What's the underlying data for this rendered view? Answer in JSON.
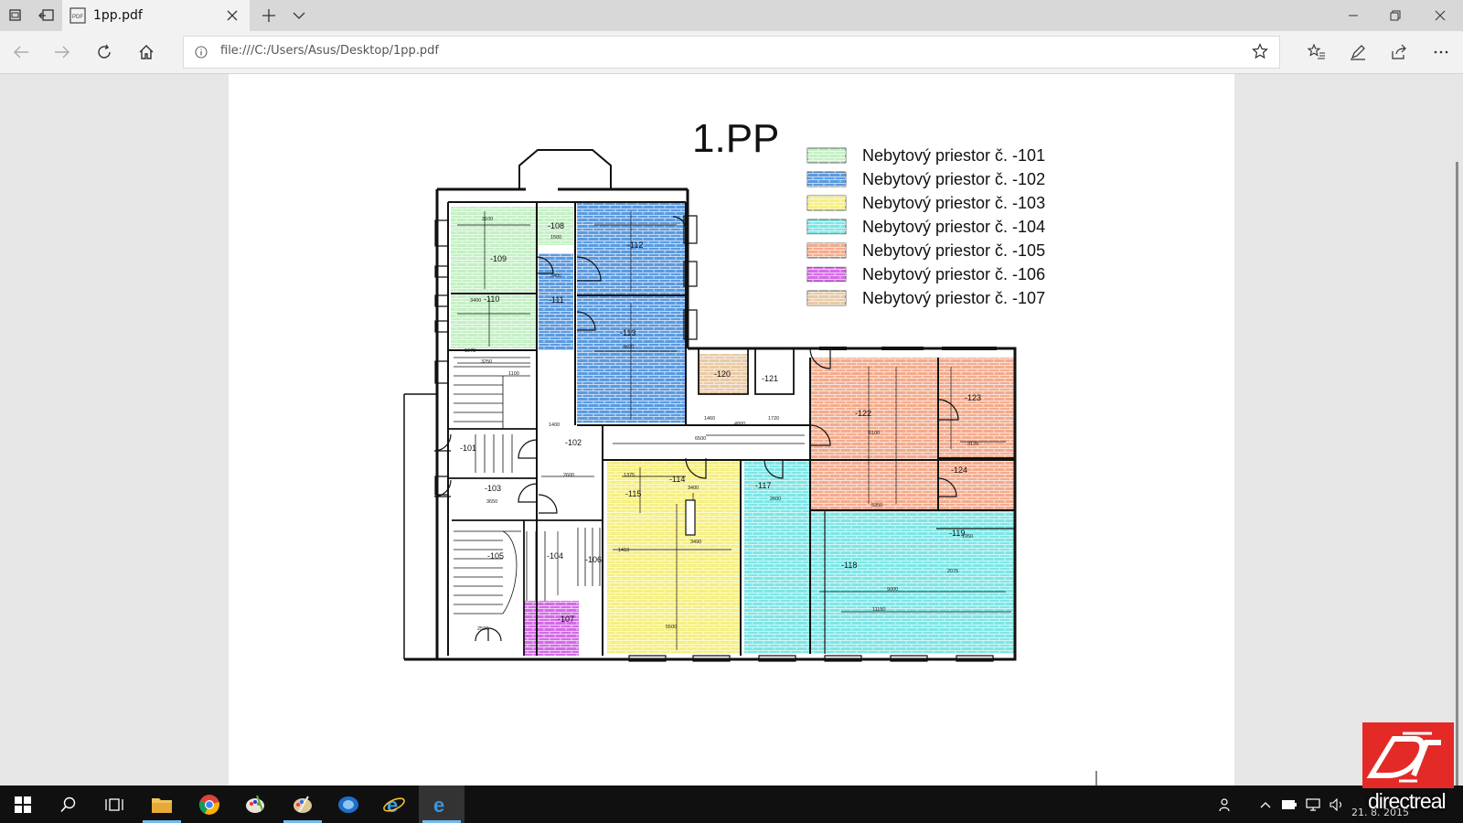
{
  "browser": {
    "tab_title": "1pp.pdf",
    "tab_file_icon_text": "PDF",
    "url": "file:///C:/Users/Asus/Desktop/1pp.pdf",
    "icons": [
      "tab-actions-icon",
      "set-aside-tabs-icon",
      "pdf-file-icon",
      "close-icon",
      "new-tab-icon",
      "chevron-down-icon",
      "minimize-icon",
      "restore-icon",
      "close-window-icon",
      "back-icon",
      "forward-icon",
      "refresh-icon",
      "home-icon",
      "info-icon",
      "star-icon",
      "favorites-icon",
      "pen-icon",
      "share-icon",
      "more-icon"
    ]
  },
  "floorplan": {
    "title": "1.PP",
    "legend": [
      {
        "label": "Nebytový priestor č. -101",
        "color": "#c4f0c4"
      },
      {
        "label": "Nebytový priestor č. -102",
        "color": "#5b9ae0"
      },
      {
        "label": "Nebytový priestor č. -103",
        "color": "#f6ef7e"
      },
      {
        "label": "Nebytový priestor č. -104",
        "color": "#7de6e6"
      },
      {
        "label": "Nebytový priestor č. -105",
        "color": "#f3ab8d"
      },
      {
        "label": "Nebytový priestor č. -106",
        "color": "#d46be6"
      },
      {
        "label": "Nebytový priestor č. -107",
        "color": "#e9c9a4"
      }
    ],
    "rooms": [
      "-101",
      "-102",
      "-103",
      "-104",
      "-105",
      "-106",
      "-107",
      "-108",
      "-109",
      "-110",
      "-111",
      "-112",
      "-113",
      "-114",
      "-115",
      "-117",
      "-118",
      "-119",
      "-120",
      "-121",
      "-122",
      "-123",
      "-124"
    ],
    "dimensions": [
      "3100",
      "1500",
      "3400",
      "3400",
      "1973",
      "3250",
      "1100",
      "1400",
      "2600",
      "3650",
      "2500",
      "6500",
      "4800",
      "4600",
      "1460",
      "1720",
      "1375",
      "3400",
      "3490",
      "1410",
      "5500",
      "2600",
      "11150",
      "5350",
      "3125",
      "2075",
      "1950",
      "6100",
      "9000"
    ]
  },
  "taskbar": {
    "clock_date": "21. 8. 2015",
    "icons": [
      "windows-start-icon",
      "search-icon",
      "task-view-icon",
      "file-explorer-icon",
      "chrome-icon",
      "paint-icon",
      "palette-icon",
      "outlook-icon",
      "internet-explorer-icon",
      "edge-icon",
      "people-icon",
      "chevron-up-icon",
      "battery-icon",
      "network-icon",
      "volume-icon"
    ]
  },
  "watermark": {
    "logo_text": "directreal"
  }
}
